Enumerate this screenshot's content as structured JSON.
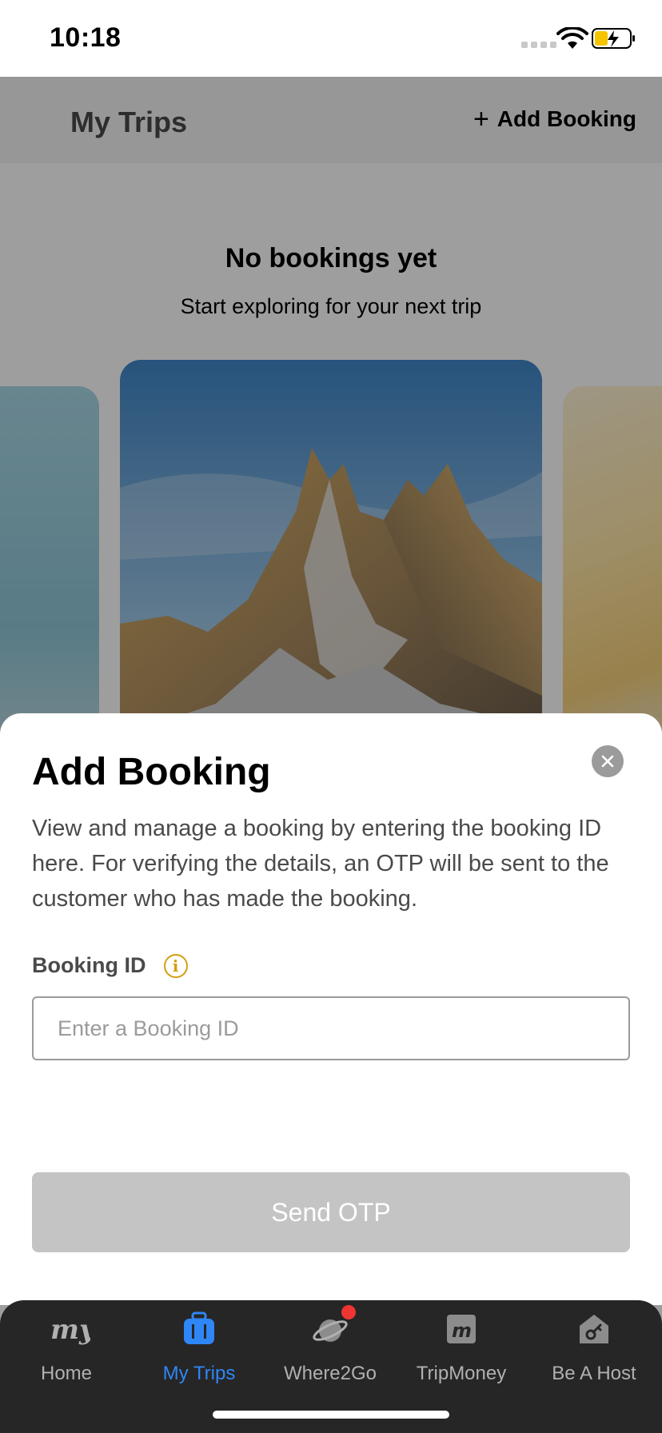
{
  "status_bar": {
    "time": "10:18"
  },
  "header": {
    "title": "My Trips",
    "add_booking_label": "Add Booking",
    "add_icon": "plus-icon"
  },
  "empty_state": {
    "title": "No bookings yet",
    "subtitle": "Start exploring for your next trip"
  },
  "sheet": {
    "title": "Add Booking",
    "description": "View and manage a booking by entering the booking ID here. For verifying the details, an OTP will be sent to the customer who has made the booking.",
    "field_label": "Booking ID",
    "field_icon": "info-icon",
    "input_placeholder": "Enter a Booking ID",
    "input_value": "",
    "submit_label": "Send OTP",
    "close_icon": "close-icon"
  },
  "tabbar": {
    "items": [
      {
        "label": "Home",
        "icon": "my-logo-icon",
        "active": false
      },
      {
        "label": "My Trips",
        "icon": "suitcase-icon",
        "active": true
      },
      {
        "label": "Where2Go",
        "icon": "planet-icon",
        "active": false,
        "badge": true
      },
      {
        "label": "TripMoney",
        "icon": "m-logo-icon",
        "active": false
      },
      {
        "label": "Be A Host",
        "icon": "house-key-icon",
        "active": false
      }
    ]
  },
  "colors": {
    "accent": "#2f86f6",
    "tabbar_bg": "#262626",
    "info": "#d39e12",
    "badge": "#ef3434",
    "disabled_button": "#c4c4c4"
  }
}
